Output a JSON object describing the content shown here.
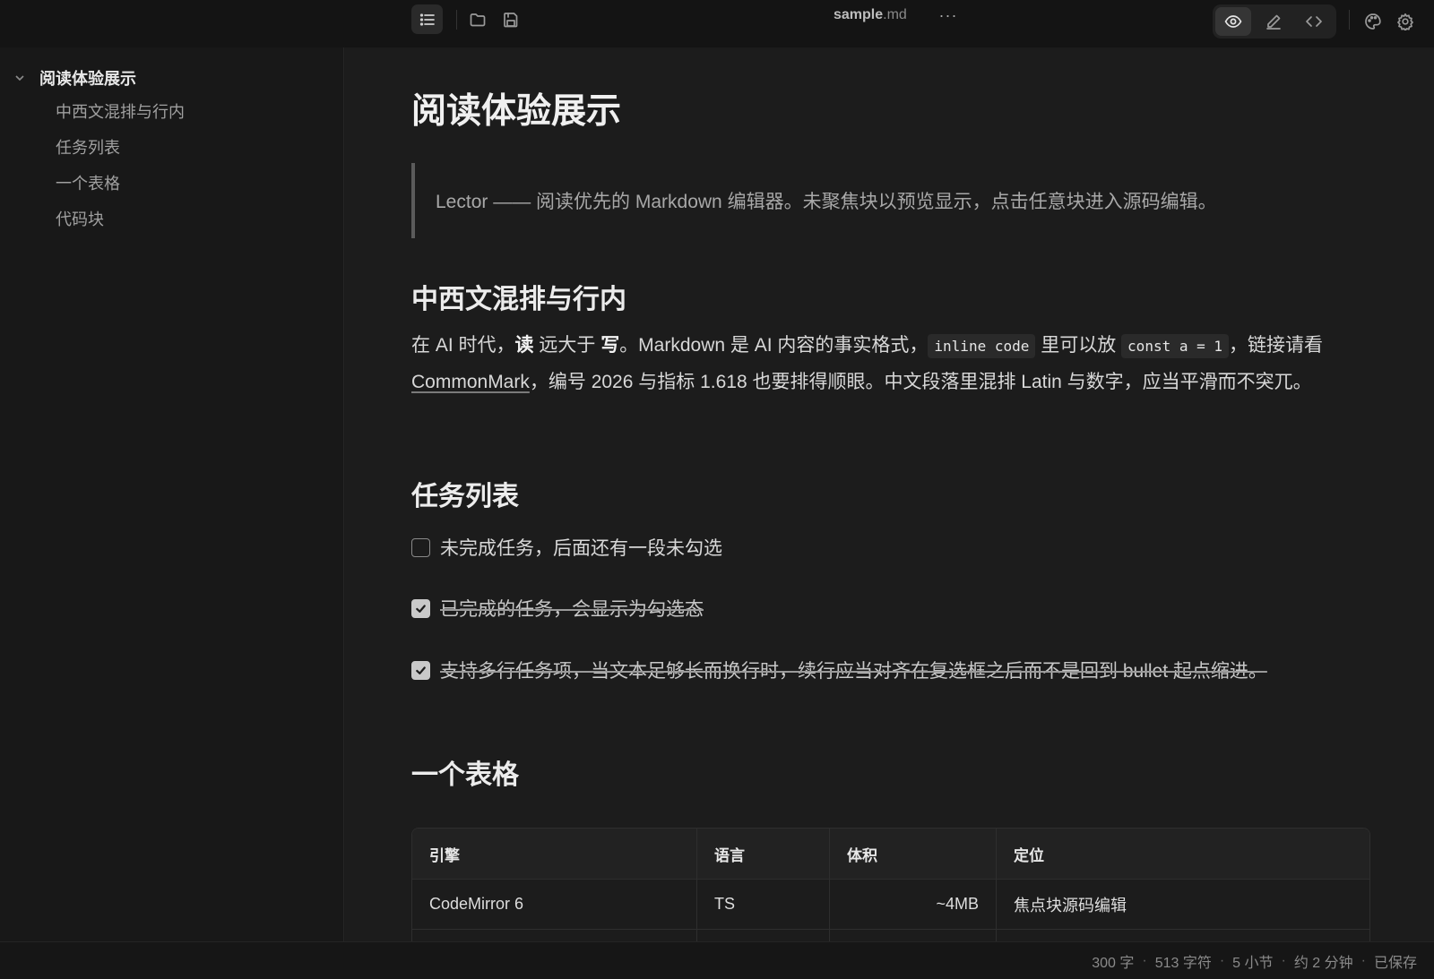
{
  "toolbar": {
    "filename_base": "sample",
    "filename_ext": ".md",
    "more": "···"
  },
  "sidebar": {
    "root": "阅读体验展示",
    "items": [
      {
        "label": "中西文混排与行内"
      },
      {
        "label": "任务列表"
      },
      {
        "label": "一个表格"
      },
      {
        "label": "代码块"
      }
    ]
  },
  "doc": {
    "title": "阅读体验展示",
    "quote": "Lector —— 阅读优先的 Markdown 编辑器。未聚焦块以预览显示，点击任意块进入源码编辑。",
    "section1": {
      "heading": "中西文混排与行内",
      "p1": "在 AI 时代，",
      "bold1": "读",
      "p2": " 远大于 ",
      "bold2": "写",
      "p3": "。Markdown 是 AI 内容的事实格式，",
      "code1": "inline code",
      "p4": " 里可以放 ",
      "code2": "const a = 1",
      "p5": "，链接请看 ",
      "link": "CommonMark",
      "p6": "，编号 2026 与指标 1.618 也要排得顺眼。中文段落里混排 Latin 与数字，应当平滑而不突兀。"
    },
    "section2": {
      "heading": "任务列表",
      "tasks": [
        {
          "text": "未完成任务，后面还有一段未勾选",
          "done": false
        },
        {
          "text": "已完成的任务，会显示为勾选态",
          "done": true
        },
        {
          "text": "支持多行任务项，当文本足够长而换行时，续行应当对齐在复选框之后而不是回到 bullet 起点缩进。",
          "done": true
        }
      ]
    },
    "section3": {
      "heading": "一个表格",
      "columns": [
        "引擎",
        "语言",
        "体积",
        "定位"
      ],
      "rows": [
        [
          "CodeMirror 6",
          "TS",
          "~4MB",
          "焦点块源码编辑"
        ]
      ]
    }
  },
  "status": {
    "words": "300 字",
    "chars": "513 字符",
    "sections": "5 小节",
    "read_time": "约 2 分钟",
    "saved": "已保存"
  }
}
